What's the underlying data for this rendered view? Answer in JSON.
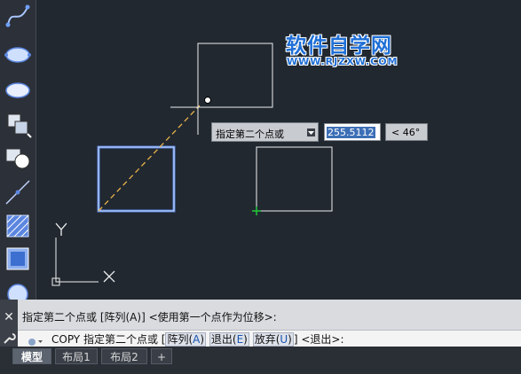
{
  "watermark": {
    "title": "软件自学网",
    "url": "WWW.RJZXW.COM"
  },
  "tooltip": {
    "prompt": "指定第二个点或",
    "value": "255.5112",
    "angle": "< 46°"
  },
  "command": {
    "history": "指定第二个点或 [阵列(A)] <使用第一个点作为位移>:",
    "name": "COPY",
    "prompt": "指定第二个点或 [",
    "options": [
      {
        "text": "阵列(",
        "key": "A",
        "end": ")"
      },
      {
        "text": "退出(",
        "key": "E",
        "end": ")"
      },
      {
        "text": "放弃(",
        "key": "U",
        "end": ")"
      }
    ],
    "suffix": "] <退出>:"
  },
  "ucs": {
    "x_label": "X",
    "y_label": "Y"
  },
  "tabs": [
    {
      "label": "模型",
      "active": true
    },
    {
      "label": "布局1",
      "active": false
    },
    {
      "label": "布局2",
      "active": false
    },
    {
      "label": "+",
      "active": false
    }
  ],
  "toolbar": {
    "tools": [
      "spline-icon",
      "ellipse-icon",
      "ellipse-arc-icon",
      "insert-block-icon",
      "make-block-icon",
      "point-icon",
      "hatch-icon",
      "gradient-icon",
      "region-icon"
    ]
  },
  "colors": {
    "canvas": "#212830",
    "selection": "#5b86e0",
    "rubberband": "#e8b24a",
    "geometry": "#f0f0f0",
    "basepoint": "#22c83a"
  }
}
